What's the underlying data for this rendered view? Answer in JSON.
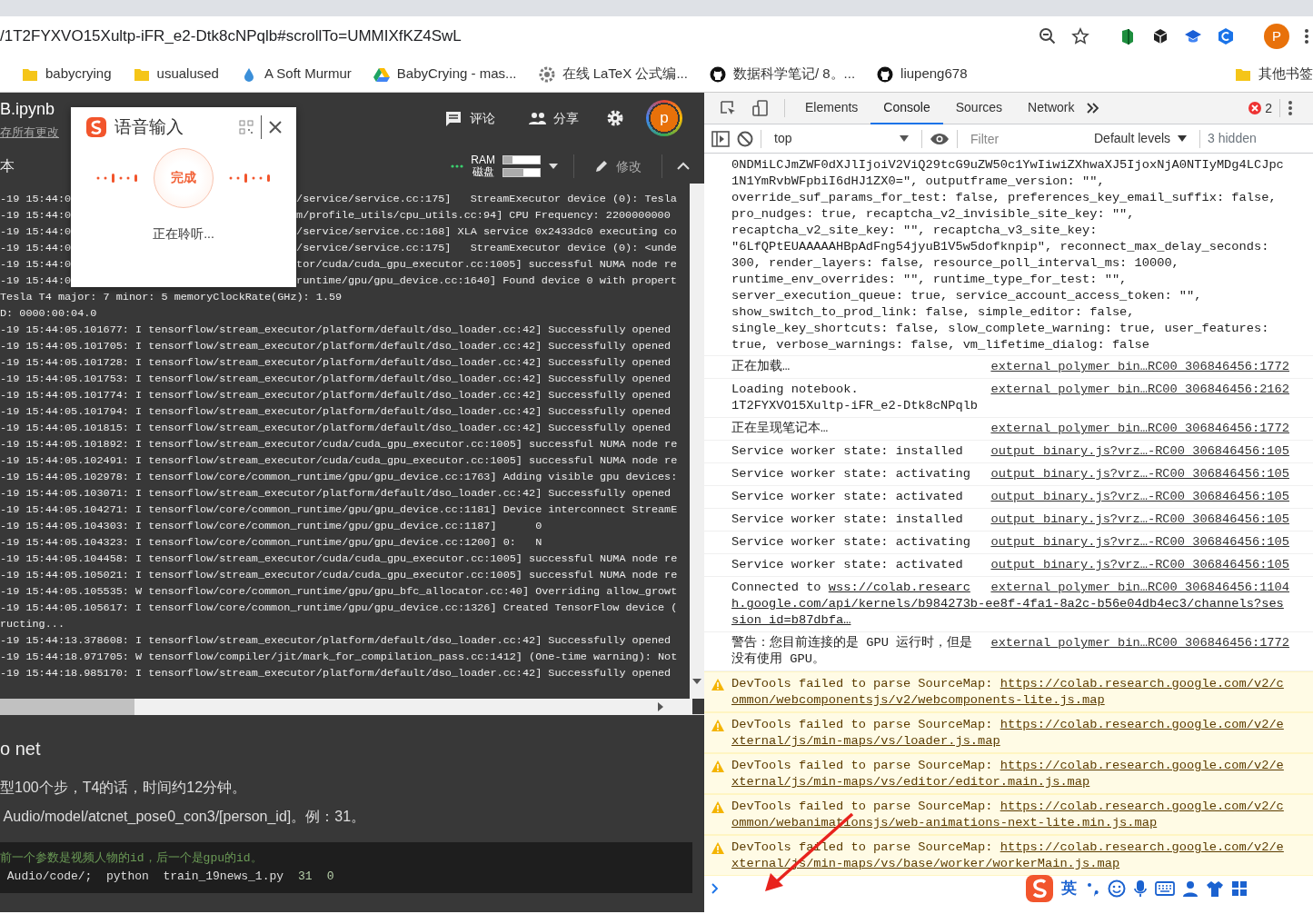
{
  "browser": {
    "url": "/1T2FYXVO15Xultp-iFR_e2-Dtk8cNPqlb#scrollTo=UMMIXfKZ4SwL",
    "profile_initial": "P",
    "bookmarks": [
      {
        "label": "babycrying",
        "kind": "folder"
      },
      {
        "label": "usualused",
        "kind": "folder"
      },
      {
        "label": "A Soft Murmur",
        "kind": "drop"
      },
      {
        "label": "BabyCrying - mas...",
        "kind": "drive"
      },
      {
        "label": "在线 LaTeX 公式编...",
        "kind": "gear"
      },
      {
        "label": "数据科学笔记/ 8。...",
        "kind": "github"
      },
      {
        "label": "liupeng678",
        "kind": "github"
      }
    ],
    "other_bookmarks": "其他书签"
  },
  "notebook": {
    "title": "B.ipynb",
    "save_link": "存所有更改",
    "actions": [
      {
        "label": "评论",
        "kind": "comment"
      },
      {
        "label": "分享",
        "kind": "share"
      }
    ],
    "avatar": "p",
    "toolbar": {
      "left": "本",
      "ram_label": "RAM",
      "disk_label": "磁盘",
      "ram": {
        "level": 0.25
      },
      "disk": {
        "level": 0.55
      },
      "edit": "修改"
    },
    "log": [
      {
        "prefix": "-19 15:44:0",
        "text": "/service/service.cc:175]   StreamExecutor device (0): Tesla"
      },
      {
        "prefix": "-19 15:44:0",
        "text": "m/profile_utils/cpu_utils.cc:94] CPU Frequency: 2200000000"
      },
      {
        "prefix": "-19 15:44:0",
        "text": "/service/service.cc:168] XLA service 0x2433dc0 executing co"
      },
      {
        "prefix": "-19 15:44:0",
        "text": "/service/service.cc:175]   StreamExecutor device (0): <unde"
      },
      {
        "prefix": "-19 15:44:0",
        "text": "tor/cuda/cuda_gpu_executor.cc:1005] successful NUMA node re"
      },
      {
        "prefix": "-19 15:44:0",
        "text": "runtime/gpu/gpu_device.cc:1640] Found device 0 with propert"
      },
      {
        "text": "Tesla T4 major: 7 minor: 5 memoryClockRate(GHz): 1.59"
      },
      {
        "text": "D: 0000:00:04.0"
      },
      {
        "text": "-19 15:44:05.101677: I tensorflow/stream_executor/platform/default/dso_loader.cc:42] Successfully opened"
      },
      {
        "text": "-19 15:44:05.101705: I tensorflow/stream_executor/platform/default/dso_loader.cc:42] Successfully opened"
      },
      {
        "text": "-19 15:44:05.101728: I tensorflow/stream_executor/platform/default/dso_loader.cc:42] Successfully opened"
      },
      {
        "text": "-19 15:44:05.101753: I tensorflow/stream_executor/platform/default/dso_loader.cc:42] Successfully opened"
      },
      {
        "text": "-19 15:44:05.101774: I tensorflow/stream_executor/platform/default/dso_loader.cc:42] Successfully opened"
      },
      {
        "text": "-19 15:44:05.101794: I tensorflow/stream_executor/platform/default/dso_loader.cc:42] Successfully opened"
      },
      {
        "text": "-19 15:44:05.101815: I tensorflow/stream_executor/platform/default/dso_loader.cc:42] Successfully opened"
      },
      {
        "text": "-19 15:44:05.101892: I tensorflow/stream_executor/cuda/cuda_gpu_executor.cc:1005] successful NUMA node re"
      },
      {
        "text": "-19 15:44:05.102491: I tensorflow/stream_executor/cuda/cuda_gpu_executor.cc:1005] successful NUMA node re"
      },
      {
        "text": "-19 15:44:05.102978: I tensorflow/core/common_runtime/gpu/gpu_device.cc:1763] Adding visible gpu devices:"
      },
      {
        "text": "-19 15:44:05.103071: I tensorflow/stream_executor/platform/default/dso_loader.cc:42] Successfully opened"
      },
      {
        "text": "-19 15:44:05.104271: I tensorflow/core/common_runtime/gpu/gpu_device.cc:1181] Device interconnect StreamE"
      },
      {
        "text": "-19 15:44:05.104303: I tensorflow/core/common_runtime/gpu/gpu_device.cc:1187]      0"
      },
      {
        "text": "-19 15:44:05.104323: I tensorflow/core/common_runtime/gpu/gpu_device.cc:1200] 0:   N"
      },
      {
        "text": "-19 15:44:05.104458: I tensorflow/stream_executor/cuda/cuda_gpu_executor.cc:1005] successful NUMA node re"
      },
      {
        "text": "-19 15:44:05.105021: I tensorflow/stream_executor/cuda/cuda_gpu_executor.cc:1005] successful NUMA node re"
      },
      {
        "text": "-19 15:44:05.105535: W tensorflow/core/common_runtime/gpu/gpu_bfc_allocator.cc:40] Overriding allow_growt"
      },
      {
        "text": "-19 15:44:05.105617: I tensorflow/core/common_runtime/gpu/gpu_device.cc:1326] Created TensorFlow device ("
      },
      {
        "text": "ructing..."
      },
      {
        "text": "-19 15:44:13.378608: I tensorflow/stream_executor/platform/default/dso_loader.cc:42] Successfully opened"
      },
      {
        "text": "-19 15:44:18.971705: W tensorflow/compiler/jit/mark_for_compilation_pass.cc:1412] (One-time warning): Not"
      },
      {
        "text": "-19 15:44:18.985170: I tensorflow/stream_executor/platform/default/dso_loader.cc:42] Successfully opened"
      }
    ],
    "text_cell": {
      "heading": "o net",
      "paragraphs": [
        "型100个步，T4的话，时间约12分钟。",
        " Audio/model/atcnet_pose0_con3/[person_id]。例：31。"
      ]
    },
    "code_cell": {
      "comment": "前一个参数是视频人物的id，后一个是gpu的id。",
      "code": " Audio/code/;  python  train_19news_1.py",
      "args": [
        "31",
        "0"
      ]
    }
  },
  "voice_popup": {
    "title": "语音输入",
    "button": "完成",
    "status": "正在聆听..."
  },
  "devtools": {
    "tabs": [
      {
        "label": "Elements",
        "selected": false
      },
      {
        "label": "Console",
        "selected": true
      },
      {
        "label": "Sources",
        "selected": false
      },
      {
        "label": "Network",
        "selected": false
      }
    ],
    "error_count": "2",
    "context": "top",
    "filter_placeholder": "Filter",
    "levels": "Default levels",
    "hidden": "3 hidden",
    "messages": [
      {
        "kind": "object",
        "lines": [
          "0NDMiLCJmZWF0dXJlIjoiV2ViQ29tcG9uZW50c1YwIiwiZXhwaXJ5IjoxNjA0NTIyMDg4LCJpc",
          "1N1YmRvbWFpbiI6dHJ1ZX0=\", outputframe_version: \"\",",
          "override_suf_params_for_test: false, preferences_key_email_suffix: false,",
          "pro_nudges: true, recaptcha_v2_invisible_site_key: \"\",",
          "recaptcha_v2_site_key: \"\", recaptcha_v3_site_key:",
          "\"6LfQPtEUAAAAAHBpAdFng54jyuB1V5w5dofknpip\", reconnect_max_delay_seconds:",
          "300, render_layers: false, resource_poll_interval_ms: 10000,",
          "runtime_env_overrides: \"\", runtime_type_for_test: \"\",",
          "server_execution_queue: true, service_account_access_token: \"\",",
          "show_switch_to_prod_link: false, simple_editor: false,",
          "single_key_shortcuts: false, slow_complete_warning: true, user_features:",
          "true, verbose_warnings: false, vm_lifetime_dialog: false"
        ]
      },
      {
        "kind": "plain",
        "text": "正在加载…",
        "source": "external_polymer_bin…RC00_306846456:1772"
      },
      {
        "kind": "plain",
        "text": "Loading notebook. 1T2FYXVO15Xultp-iFR_e2-Dtk8cNPqlb",
        "source": "external_polymer_bin…RC00_306846456:2162"
      },
      {
        "kind": "plain",
        "text": "正在呈现笔记本…",
        "source": "external_polymer_bin…RC00_306846456:1772"
      },
      {
        "kind": "plain",
        "text": "Service worker state: installed",
        "source": "output_binary.js?vrz…-RC00_306846456:105"
      },
      {
        "kind": "plain",
        "text": "Service worker state: activating",
        "source": "output_binary.js?vrz…-RC00_306846456:105"
      },
      {
        "kind": "plain",
        "text": "Service worker state: activated",
        "source": "output_binary.js?vrz…-RC00_306846456:105"
      },
      {
        "kind": "plain",
        "text": "Service worker state: installed",
        "source": "output_binary.js?vrz…-RC00_306846456:105"
      },
      {
        "kind": "plain",
        "text": "Service worker state: activating",
        "source": "output_binary.js?vrz…-RC00_306846456:105"
      },
      {
        "kind": "plain",
        "text": "Service worker state: activated",
        "source": "output_binary.js?vrz…-RC00_306846456:105"
      },
      {
        "kind": "link",
        "text": "Connected to",
        "url": "wss://colab.researc",
        "url_continued": "h.google.com/api/kernels/b984273b-ee8f-4fa1-8a2c-b56e04db4ec3/channels?session_id=b87dbfa…",
        "source": "external_polymer_bin…RC00_306846456:1104"
      },
      {
        "kind": "plain",
        "text": "警告：您目前连接的是 GPU 运行时，但是没有使用 GPU。",
        "source": "external_polymer_bin…RC00_306846456:1772"
      },
      {
        "kind": "warning",
        "text": "DevTools failed to parse SourceMap:",
        "url": "https://colab.research.google.com/v2/common/webcomponentsjs/v2/webcomponents-lite.js.map"
      },
      {
        "kind": "warning",
        "text": "DevTools failed to parse SourceMap:",
        "url": "https://colab.research.google.com/v2/external/js/min-maps/vs/loader.js.map"
      },
      {
        "kind": "warning",
        "text": "DevTools failed to parse SourceMap:",
        "url": "https://colab.research.google.com/v2/external/js/min-maps/vs/editor/editor.main.js.map"
      },
      {
        "kind": "warning",
        "text": "DevTools failed to parse SourceMap:",
        "url": "https://colab.research.google.com/v2/common/webanimationsjs/web-animations-next-lite.min.js.map"
      },
      {
        "kind": "warning",
        "text": "DevTools failed to parse SourceMap:",
        "url": "https://colab.research.google.com/v2/external/js/min-maps/vs/base/worker/workerMain.js.map"
      }
    ]
  },
  "ime_bar": {
    "mode": "英"
  }
}
